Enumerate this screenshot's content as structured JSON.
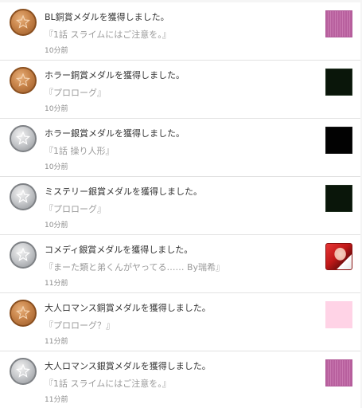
{
  "notifications": [
    {
      "medal": "bronze",
      "title": "BL銅賞メダルを獲得しました。",
      "subtitle": "『1話 スライムにはご注意を。』",
      "time": "10分前",
      "thumbnail": "purple-striped"
    },
    {
      "medal": "bronze",
      "title": "ホラー銅賞メダルを獲得しました。",
      "subtitle": "『プロローグ』",
      "time": "10分前",
      "thumbnail": "dark-green"
    },
    {
      "medal": "silver",
      "title": "ホラー銀賞メダルを獲得しました。",
      "subtitle": "『1話 操り人形』",
      "time": "10分前",
      "thumbnail": "black"
    },
    {
      "medal": "silver",
      "title": "ミステリー銀賞メダルを獲得しました。",
      "subtitle": "『プロローグ』",
      "time": "10分前",
      "thumbnail": "dark-green"
    },
    {
      "medal": "silver",
      "title": "コメディ銀賞メダルを獲得しました。",
      "subtitle": "『まーた類と弟くんがヤってる…… By瑞希』",
      "time": "11分前",
      "thumbnail": "anime-character"
    },
    {
      "medal": "bronze",
      "title": "大人ロマンス銅賞メダルを獲得しました。",
      "subtitle": "『プロローグ？』",
      "time": "11分前",
      "thumbnail": "pink"
    },
    {
      "medal": "silver",
      "title": "大人ロマンス銀賞メダルを獲得しました。",
      "subtitle": "『1話 スライムにはご注意を。』",
      "time": "11分前",
      "thumbnail": "purple-striped"
    }
  ],
  "colors": {
    "bronze": "#c8844a",
    "silver": "#c4c6c9",
    "title_text": "#333333",
    "subtitle_text": "#9a9a9a"
  },
  "icons": {
    "medal_emblem": "medal-star-icon"
  }
}
